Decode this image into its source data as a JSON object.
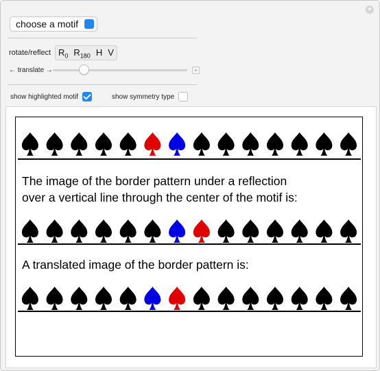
{
  "controls": {
    "motif_button_label": "choose a motif",
    "motif_color": "#1e88f0",
    "rotate_reflect_label": "rotate/reflect",
    "transform_options": [
      {
        "main": "R",
        "sub": "0"
      },
      {
        "main": "R",
        "sub": "180"
      },
      {
        "main": "H",
        "sub": ""
      },
      {
        "main": "V",
        "sub": ""
      }
    ],
    "translate_label": "← translate →",
    "translate_value": 0.23,
    "show_highlighted_motif_label": "show highlighted motif",
    "show_highlighted_motif_checked": true,
    "show_symmetry_type_label": "show symmetry type",
    "show_symmetry_type_checked": false
  },
  "display": {
    "caption1_line1": "The image of the border pattern under a reflection",
    "caption1_line2": "over a vertical line through the center of the motif is:",
    "caption2": "A translated image of the border pattern is:",
    "rows": [
      [
        "#000000",
        "#000000",
        "#000000",
        "#000000",
        "#000000",
        "#e00000",
        "#0000e6",
        "#000000",
        "#000000",
        "#000000",
        "#000000",
        "#000000",
        "#000000",
        "#000000"
      ],
      [
        "#000000",
        "#000000",
        "#000000",
        "#000000",
        "#000000",
        "#000000",
        "#0000e6",
        "#e00000",
        "#000000",
        "#000000",
        "#000000",
        "#000000",
        "#000000",
        "#000000"
      ],
      [
        "#000000",
        "#000000",
        "#000000",
        "#000000",
        "#000000",
        "#0000e6",
        "#e00000",
        "#000000",
        "#000000",
        "#000000",
        "#000000",
        "#000000",
        "#000000",
        "#000000"
      ]
    ]
  }
}
